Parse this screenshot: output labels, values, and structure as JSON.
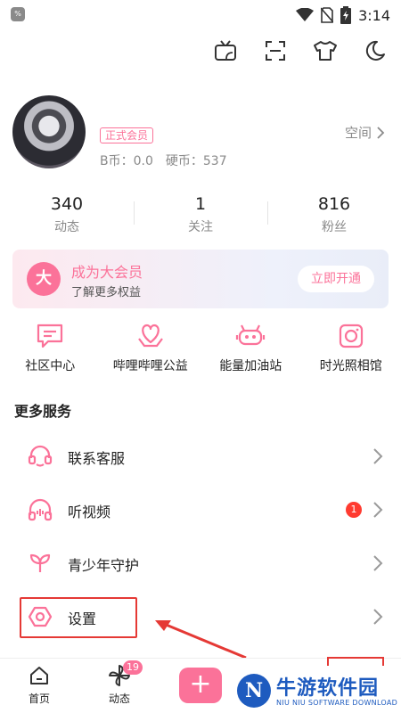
{
  "status_bar": {
    "app_icon_text": "%",
    "time": "3:14"
  },
  "profile": {
    "vip_tag": "正式会员",
    "b_coins": "B币：0.0",
    "hard_coins": "硬币：537",
    "space_label": "空间"
  },
  "stats": [
    {
      "value": "340",
      "label": "动态"
    },
    {
      "value": "1",
      "label": "关注"
    },
    {
      "value": "816",
      "label": "粉丝"
    }
  ],
  "vip_banner": {
    "badge": "大",
    "title": "成为大会员",
    "subtitle": "了解更多权益",
    "button": "立即开通"
  },
  "shortcuts": [
    {
      "label": "社区中心",
      "icon": "chat-bubble-icon"
    },
    {
      "label": "哔哩哔哩公益",
      "icon": "heart-hands-icon"
    },
    {
      "label": "能量加油站",
      "icon": "energy-station-icon"
    },
    {
      "label": "时光照相馆",
      "icon": "camera-icon"
    }
  ],
  "more_services": {
    "title": "更多服务",
    "items": [
      {
        "label": "联系客服",
        "icon": "headset-icon"
      },
      {
        "label": "听视频",
        "icon": "headphones-icon",
        "badge": "1"
      },
      {
        "label": "青少年守护",
        "icon": "sprout-icon"
      },
      {
        "label": "设置",
        "icon": "settings-hexagon-icon"
      }
    ]
  },
  "bottom_nav": {
    "home": "首页",
    "dynamic": "动态",
    "dynamic_badge": "19",
    "plus": "+"
  },
  "watermark": {
    "logo": "N",
    "name": "牛游软件园",
    "sub": "NIU NIU SOFTWARE DOWNLOAD"
  },
  "colors": {
    "accent": "#fb7299",
    "annotation": "#e53935",
    "watermark": "#1e5bbf"
  }
}
